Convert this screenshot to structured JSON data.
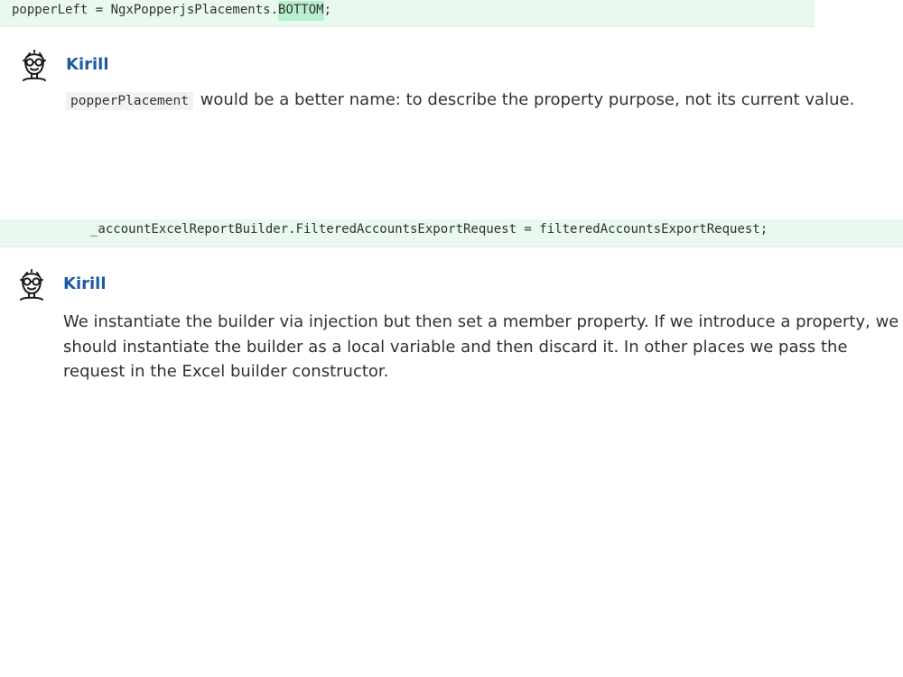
{
  "threads": [
    {
      "code_line": {
        "before": "popperLeft = NgxPopperjsPlacements.",
        "highlight": "BOTTOM",
        "after": ";"
      },
      "comment": {
        "avatar_icon": "face-glasses-icon",
        "author": "Kirill",
        "inline_code": "popperPlacement",
        "text": "would be a better name: to describe the property purpose, not its current value."
      }
    },
    {
      "code_line": {
        "text": "_accountExcelReportBuilder.FilteredAccountsExportRequest = filteredAccountsExportRequest;"
      },
      "comment": {
        "avatar_icon": "face-glasses-icon",
        "author": "Kirill",
        "text": "We instantiate the builder via injection but then set a member property. If we introduce a property, we should instantiate the builder as a local variable and then discard it. In other places we pass the request in the Excel builder constructor."
      }
    }
  ],
  "colors": {
    "code_band_bg": "#eaf9ef",
    "code_highlight_bg": "#b7efcf",
    "author_color": "#1d5aa6",
    "body_text": "#323130"
  }
}
